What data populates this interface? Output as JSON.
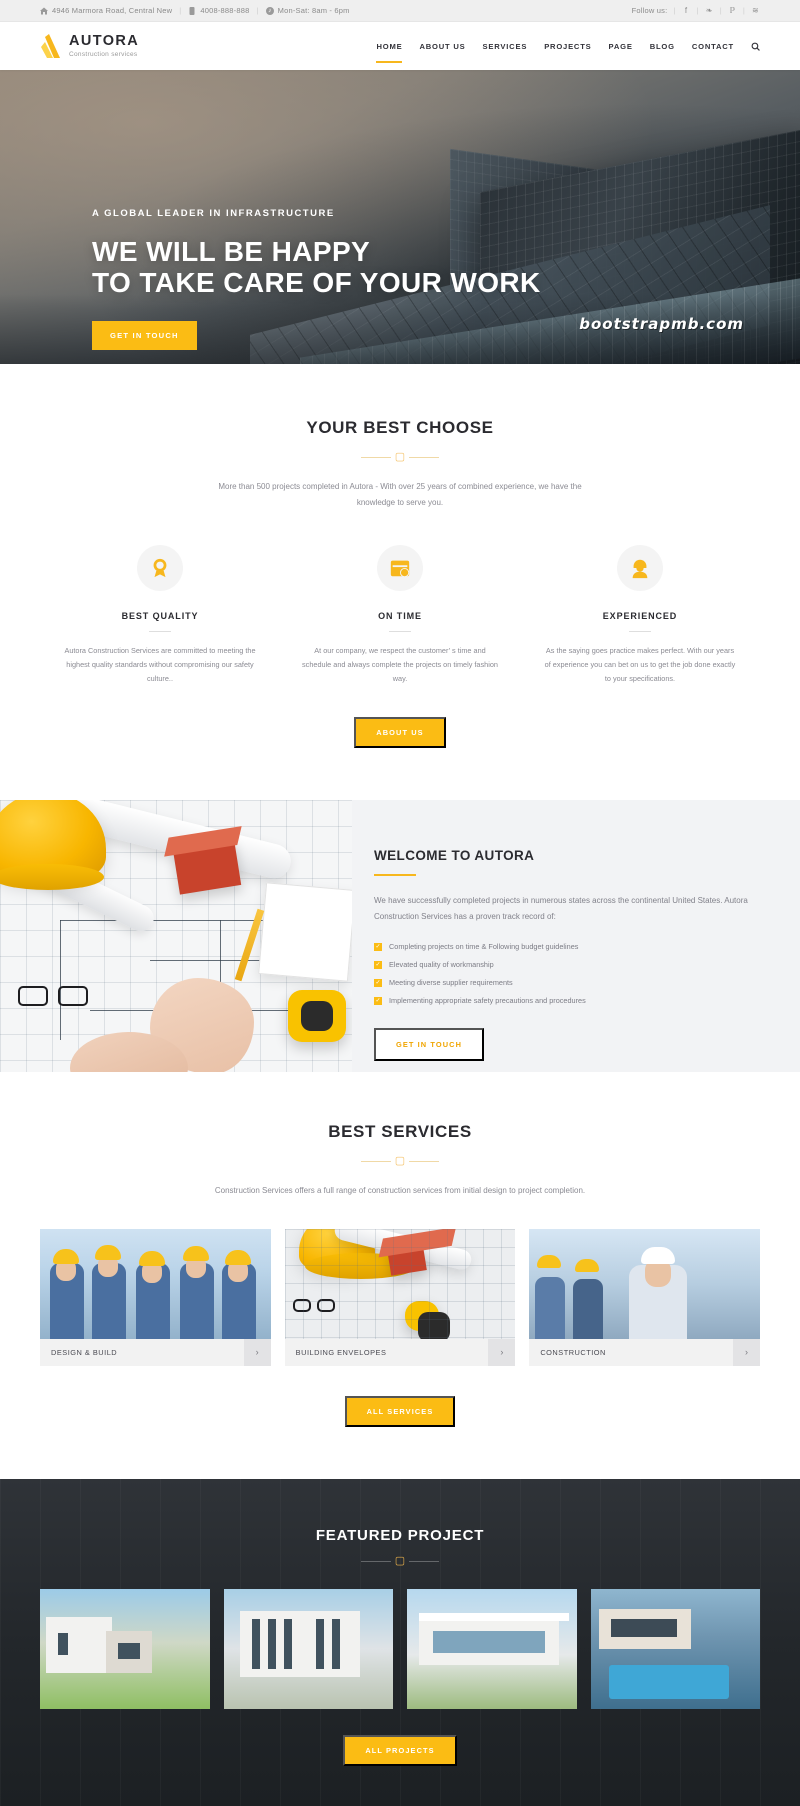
{
  "topbar": {
    "address": "4946 Marmora Road, Central New",
    "phone": "4008-888-888",
    "hours": "Mon-Sat: 8am - 6pm",
    "follow_label": "Follow us:",
    "socials": [
      "f",
      "❧",
      "ℙ",
      "≋"
    ],
    "sep": "|"
  },
  "brand": {
    "name": "AUTORA",
    "tagline": "Construction services"
  },
  "nav": {
    "items": [
      {
        "label": "HOME",
        "active": true
      },
      {
        "label": "ABOUT US",
        "active": false
      },
      {
        "label": "SERVICES",
        "active": false
      },
      {
        "label": "PROJECTS",
        "active": false
      },
      {
        "label": "PAGE",
        "active": false
      },
      {
        "label": "BLOG",
        "active": false
      },
      {
        "label": "CONTACT",
        "active": false
      }
    ]
  },
  "hero": {
    "eyebrow": "A GLOBAL LEADER IN INFRASTRUCTURE",
    "title_line1": "WE WILL BE HAPPY",
    "title_line2": "TO TAKE CARE OF YOUR WORK",
    "cta": "GET IN TOUCH",
    "watermark": "bootstrapmb.com"
  },
  "choose": {
    "title": "YOUR BEST CHOOSE",
    "lead": "More than 500 projects completed in Autora - With over 25 years of combined experience, we have the knowledge to serve you.",
    "cta": "ABOUT US",
    "columns": [
      {
        "icon": "award-badge-icon",
        "title": "BEST QUALITY",
        "text": "Autora Construction Services are committed to meeting the highest quality standards without compromising our safety culture.."
      },
      {
        "icon": "calendar-clock-icon",
        "title": "ON TIME",
        "text": "At our company, we respect the customer’ s time and schedule and always complete the projects on timely fashion way."
      },
      {
        "icon": "worker-helmet-icon",
        "title": "EXPERIENCED",
        "text": "As the saying goes practice makes perfect. With our years of experience you can bet on us to get the job done exactly to your specifications."
      }
    ]
  },
  "welcome": {
    "title": "WELCOME TO AUTORA",
    "paragraph": "We have successfully completed projects in numerous states across the continental United States. Autora Construction Services has a proven track record of:",
    "bullets": [
      "Completing projects on time & Following budget guidelines",
      "Elevated quality of workmanship",
      "Meeting diverse supplier requirements",
      "Implementing appropriate safety precautions and procedures"
    ],
    "cta": "GET IN TOUCH"
  },
  "services": {
    "title": "BEST SERVICES",
    "lead": "Construction Services offers a full range of construction services from initial design to project completion.",
    "cta": "ALL SERVICES",
    "cards": [
      {
        "label": "DESIGN & BUILD",
        "arrow": "›"
      },
      {
        "label": "BUILDING ENVELOPES",
        "arrow": "›"
      },
      {
        "label": "CONSTRUCTION",
        "arrow": "›"
      }
    ]
  },
  "featured": {
    "title": "FEATURED PROJECT",
    "cta": "ALL PROJECTS",
    "projects": [
      "project-1",
      "project-2",
      "project-3",
      "project-4"
    ]
  },
  "colors": {
    "accent": "#fbbc14",
    "accent_soft": "#f7b71d",
    "dark": "#2b2b30",
    "topbar_bg": "#efefef",
    "section_alt_bg": "#f2f3f5",
    "featured_bg": "#23272b"
  }
}
